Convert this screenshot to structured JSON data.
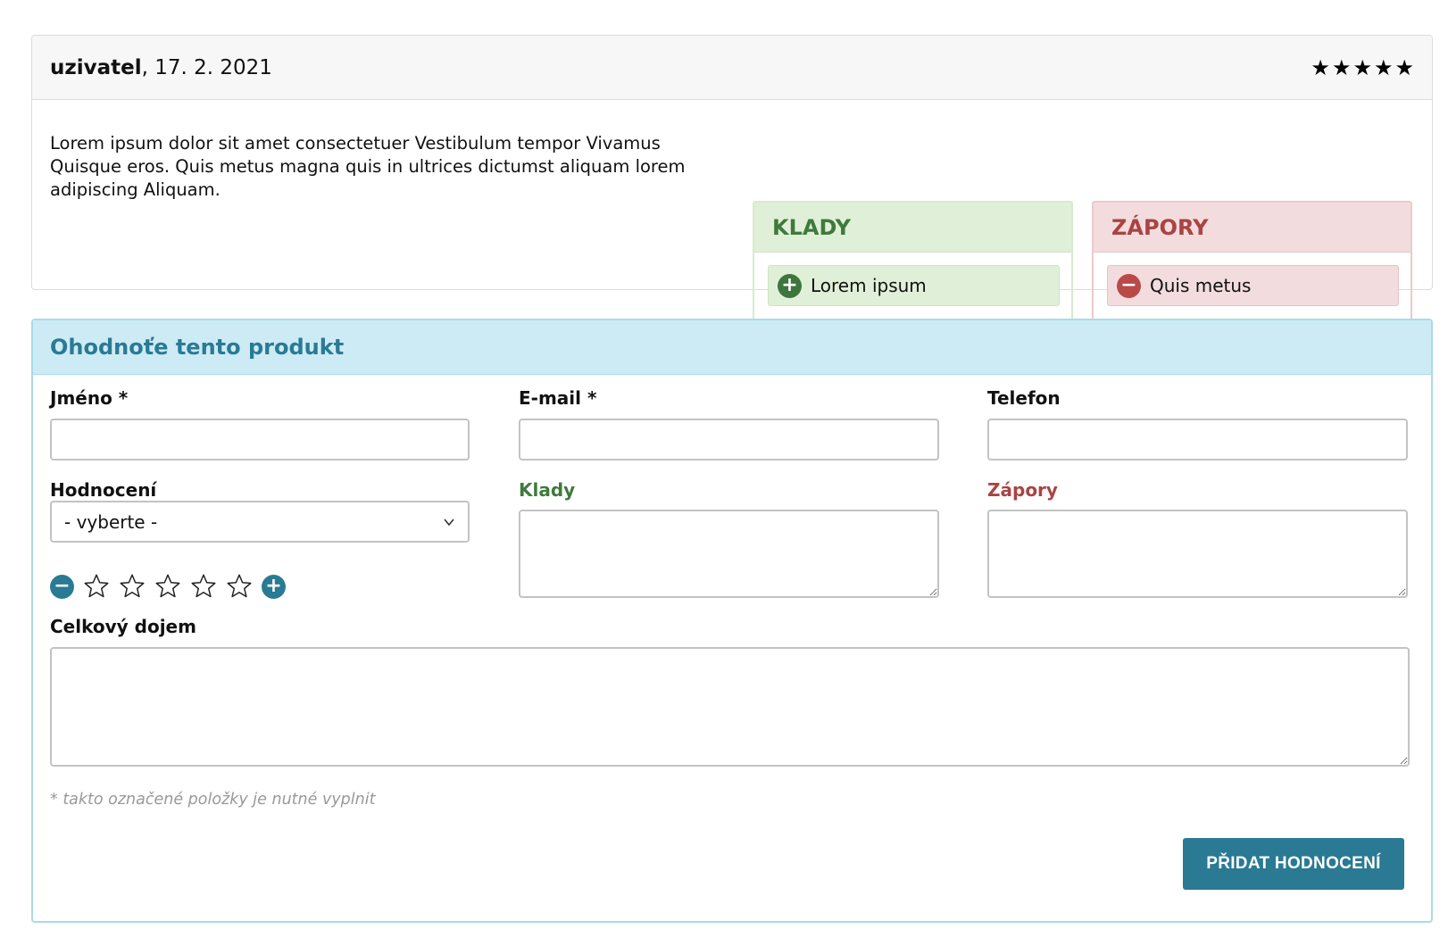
{
  "review": {
    "author": "uzivatel",
    "date": ", 17. 2. 2021",
    "rating": 5,
    "text": "Lorem ipsum dolor sit amet consectetuer Vestibulum tempor Vivamus Quisque eros. Quis metus magna quis in ultrices dictumst aliquam lorem adipiscing Aliquam.",
    "pros": {
      "title": "KLADY",
      "items": [
        "Lorem ipsum"
      ]
    },
    "cons": {
      "title": "ZÁPORY",
      "items": [
        "Quis metus"
      ]
    }
  },
  "form": {
    "title": "Ohodnoťe tento produkt",
    "name_label": "Jméno *",
    "email_label": "E-mail *",
    "phone_label": "Telefon",
    "name_value": "",
    "email_value": "",
    "phone_value": "",
    "rating_label": "Hodnocení",
    "rating_select_value": "- vyberte -",
    "rating_stars": 0,
    "pros_label": "Klady",
    "cons_label": "Zápory",
    "overall_label": "Celkový dojem",
    "required_note": "* takto označené položky je nutné vyplnit",
    "submit_label": "PŘIDAT HODNOCENÍ"
  },
  "colors": {
    "accent": "#2a7a94",
    "pros": "#3f7a3c",
    "cons": "#a94442"
  }
}
